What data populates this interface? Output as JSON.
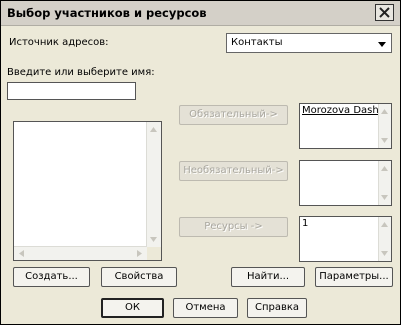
{
  "window": {
    "title": "Выбор участников и ресурсов"
  },
  "source": {
    "label": "Источник адресов:",
    "value": "Контакты"
  },
  "name_input": {
    "label": "Введите или выберите имя:",
    "value": ""
  },
  "buttons": {
    "required": "Обязательный->",
    "optional": "Необязательный->",
    "resources": "Ресурсы ->",
    "create": "Создать...",
    "properties": "Свойства",
    "find": "Найти...",
    "options": "Параметры...",
    "ok": "ОК",
    "cancel": "Отмена",
    "help": "Справка"
  },
  "lists": {
    "required": [
      "Morozova Dasha"
    ],
    "optional": [],
    "resources": [
      "1"
    ]
  }
}
